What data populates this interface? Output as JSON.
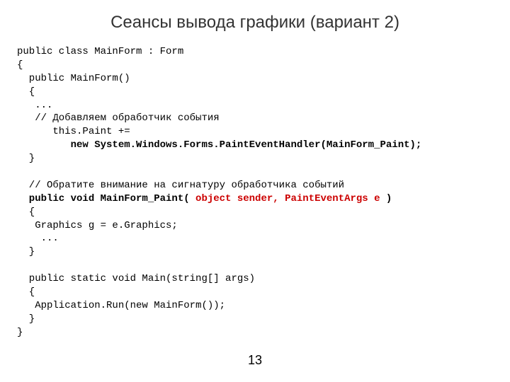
{
  "title": "Сеансы вывода графики (вариант 2)",
  "pageNumber": "13",
  "code": {
    "l01": "public class MainForm : Form",
    "l02": "{",
    "l03": "  public MainForm()",
    "l04": "  {",
    "l05": "   ...",
    "l06": "   // Добавляем обработчик события",
    "l07": "      this.Paint +=",
    "l08": "         new System.Windows.Forms.PaintEventHandler(MainForm_Paint);",
    "l09": "  }",
    "l10": "",
    "l11": "  // Обратите внимание на сигнатуру обработчика событий",
    "l12a": "  public void MainForm_Paint( ",
    "l12b": "object sender, PaintEventArgs e",
    "l12c": " )",
    "l13": "  {",
    "l14": "   Graphics g = e.Graphics;",
    "l15": "    ...",
    "l16": "  }",
    "l17": "",
    "l18": "  public static void Main(string[] args)",
    "l19": "  {",
    "l20": "   Application.Run(new MainForm());",
    "l21": "  }",
    "l22": "}"
  }
}
